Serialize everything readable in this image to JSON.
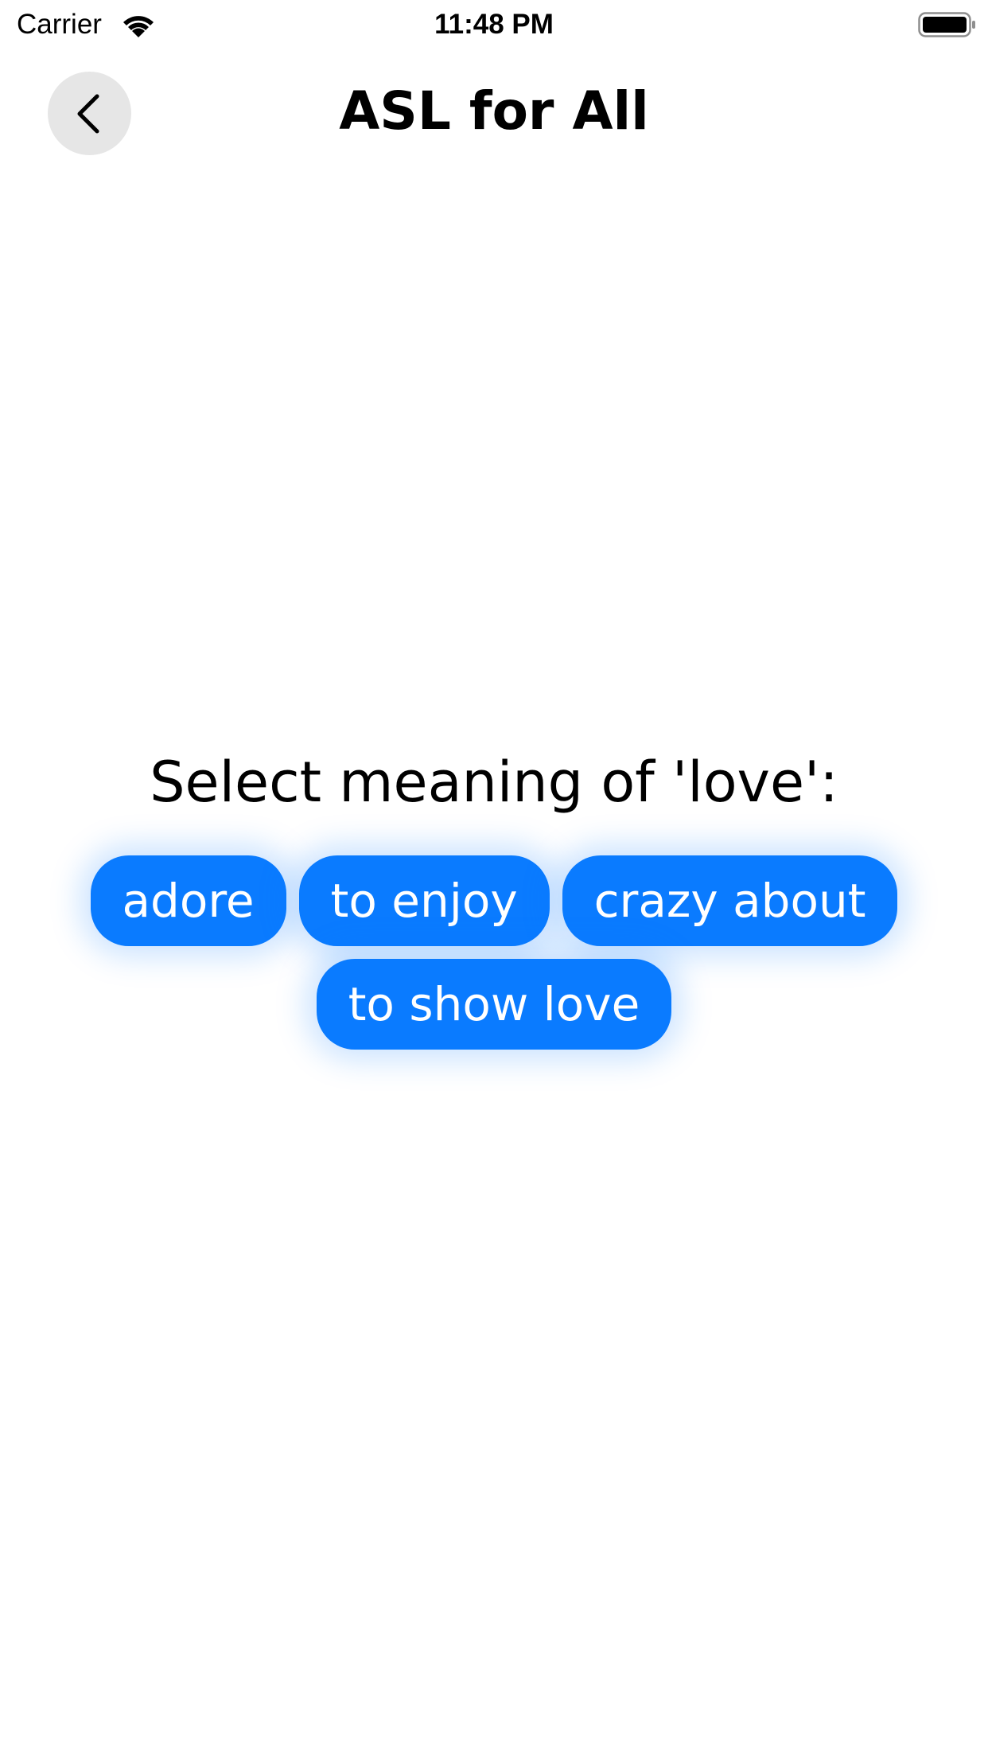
{
  "status_bar": {
    "carrier": "Carrier",
    "time": "11:48 PM",
    "wifi_icon": "wifi-icon",
    "battery_icon": "battery-full-icon"
  },
  "nav": {
    "title": "ASL for All",
    "back_icon": "chevron-left-icon"
  },
  "quiz": {
    "prompt": "Select meaning of 'love':",
    "options": [
      "adore",
      "to enjoy",
      "crazy about",
      "to show love"
    ]
  },
  "colors": {
    "accent": "#0a7bff",
    "back_button_bg": "#e6e6e6",
    "background": "#ffffff"
  }
}
